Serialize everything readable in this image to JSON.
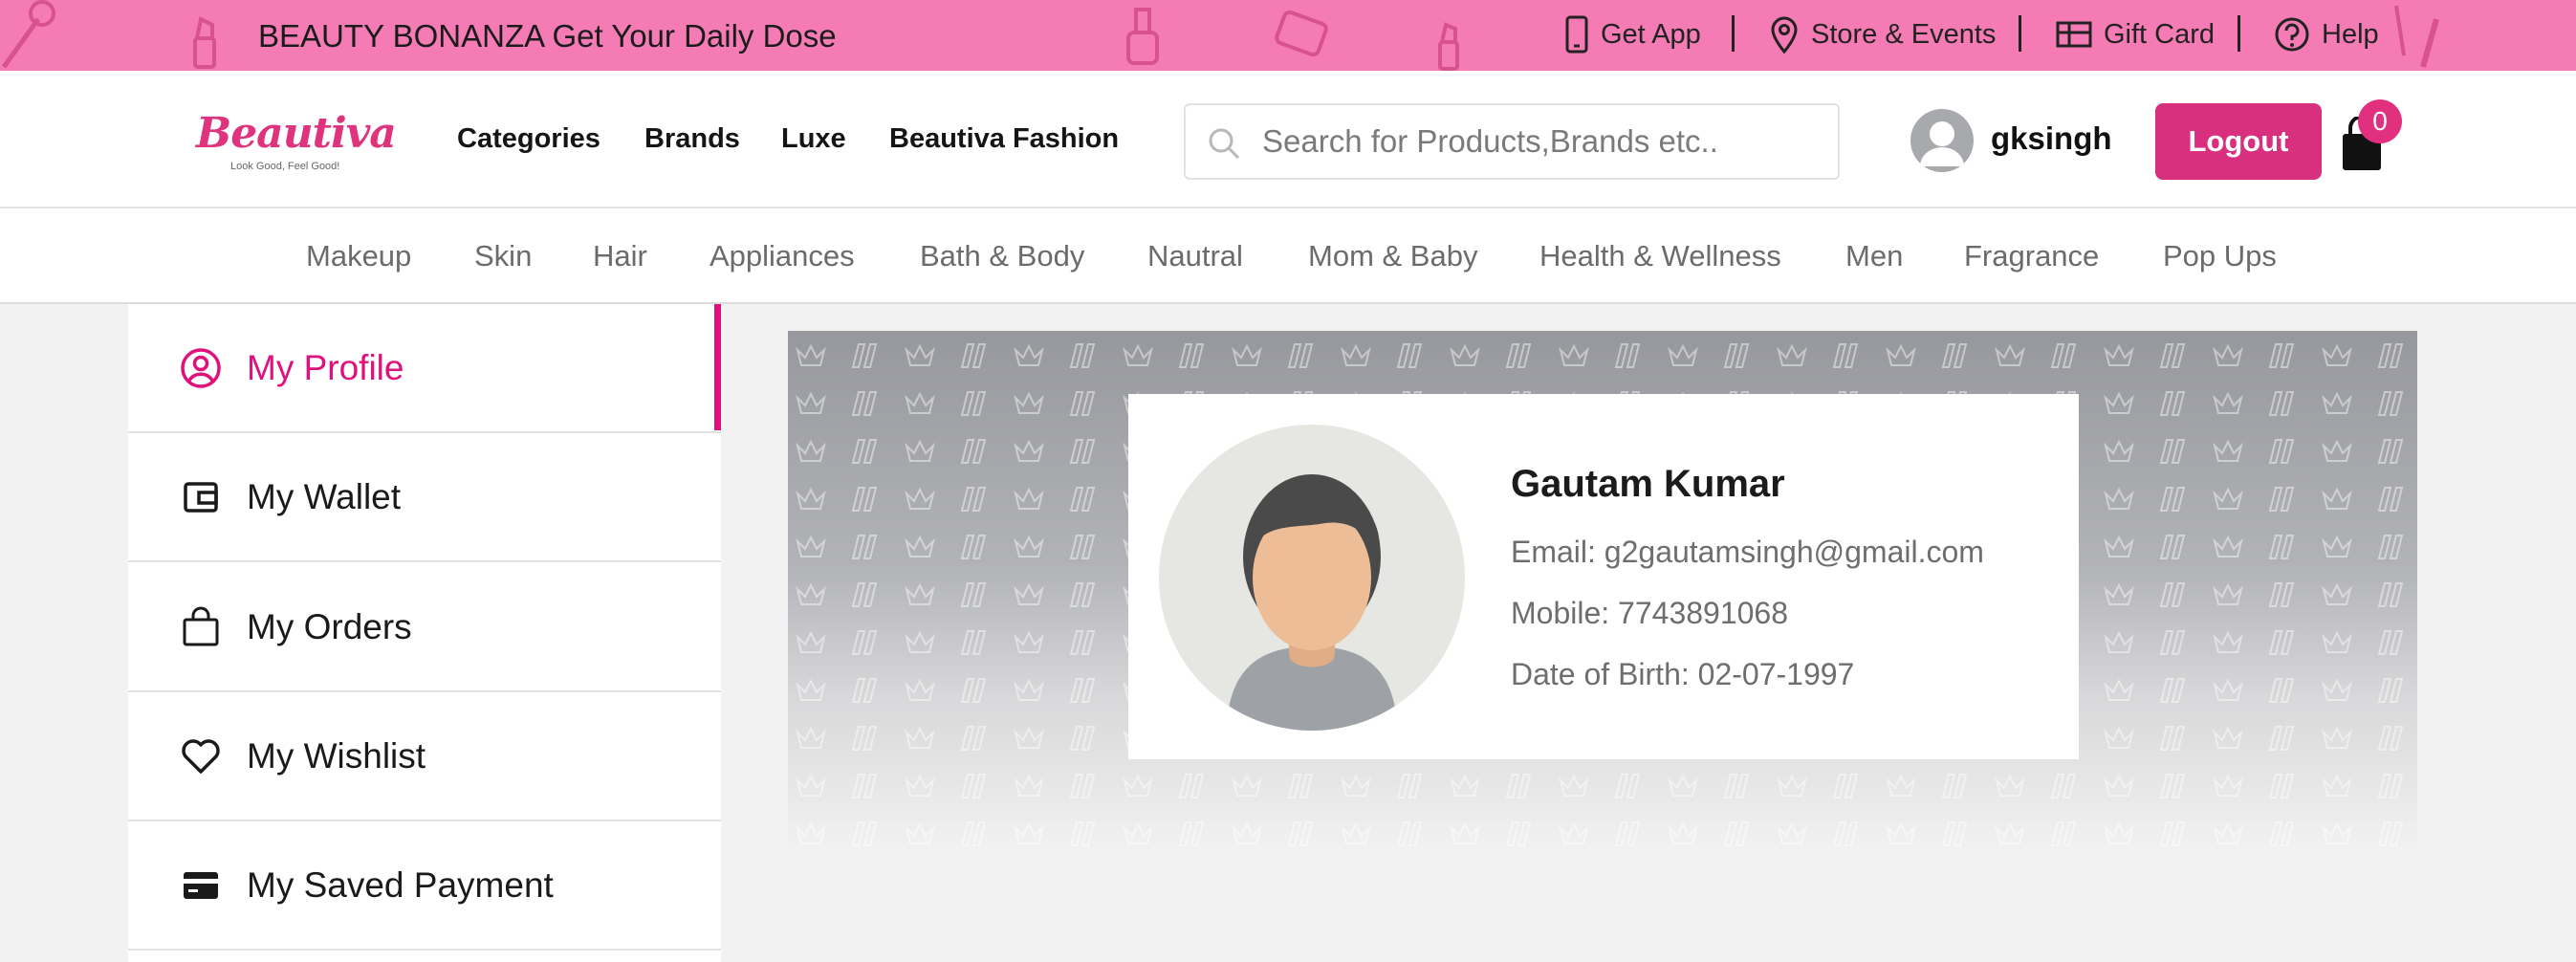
{
  "promo": {
    "text": "BEAUTY BONANZA Get Your Daily Dose",
    "background": "#f57bb4"
  },
  "utility_links": [
    {
      "label": "Get App",
      "icon": "phone-icon"
    },
    {
      "label": "Store & Events",
      "icon": "location-pin-icon"
    },
    {
      "label": "Gift Card",
      "icon": "gift-card-icon"
    },
    {
      "label": "Help",
      "icon": "help-circle-icon"
    }
  ],
  "header": {
    "logo_text": "Beautiva",
    "logo_tagline": "Look Good, Feel Good!",
    "nav": [
      "Categories",
      "Brands",
      "Luxe",
      "Beautiva Fashion"
    ],
    "search_placeholder": "Search for Products,Brands etc..",
    "username": "gksingh",
    "logout_label": "Logout",
    "cart_count": "0",
    "accent": "#d8307e"
  },
  "categories": [
    "Makeup",
    "Skin",
    "Hair",
    "Appliances",
    "Bath & Body",
    "Nautral",
    "Mom & Baby",
    "Health & Wellness",
    "Men",
    "Fragrance",
    "Pop Ups"
  ],
  "sidebar": {
    "items": [
      {
        "label": "My Profile",
        "icon": "user-circle-icon",
        "active": true
      },
      {
        "label": "My Wallet",
        "icon": "wallet-icon"
      },
      {
        "label": "My Orders",
        "icon": "shopping-bag-icon"
      },
      {
        "label": "My Wishlist",
        "icon": "heart-icon"
      },
      {
        "label": "My Saved Payment",
        "icon": "credit-card-icon"
      }
    ]
  },
  "profile": {
    "name": "Gautam Kumar",
    "email": "Email: g2gautamsingh@gmail.com",
    "mobile": "Mobile: 7743891068",
    "dob": "Date of Birth: 02-07-1997"
  }
}
